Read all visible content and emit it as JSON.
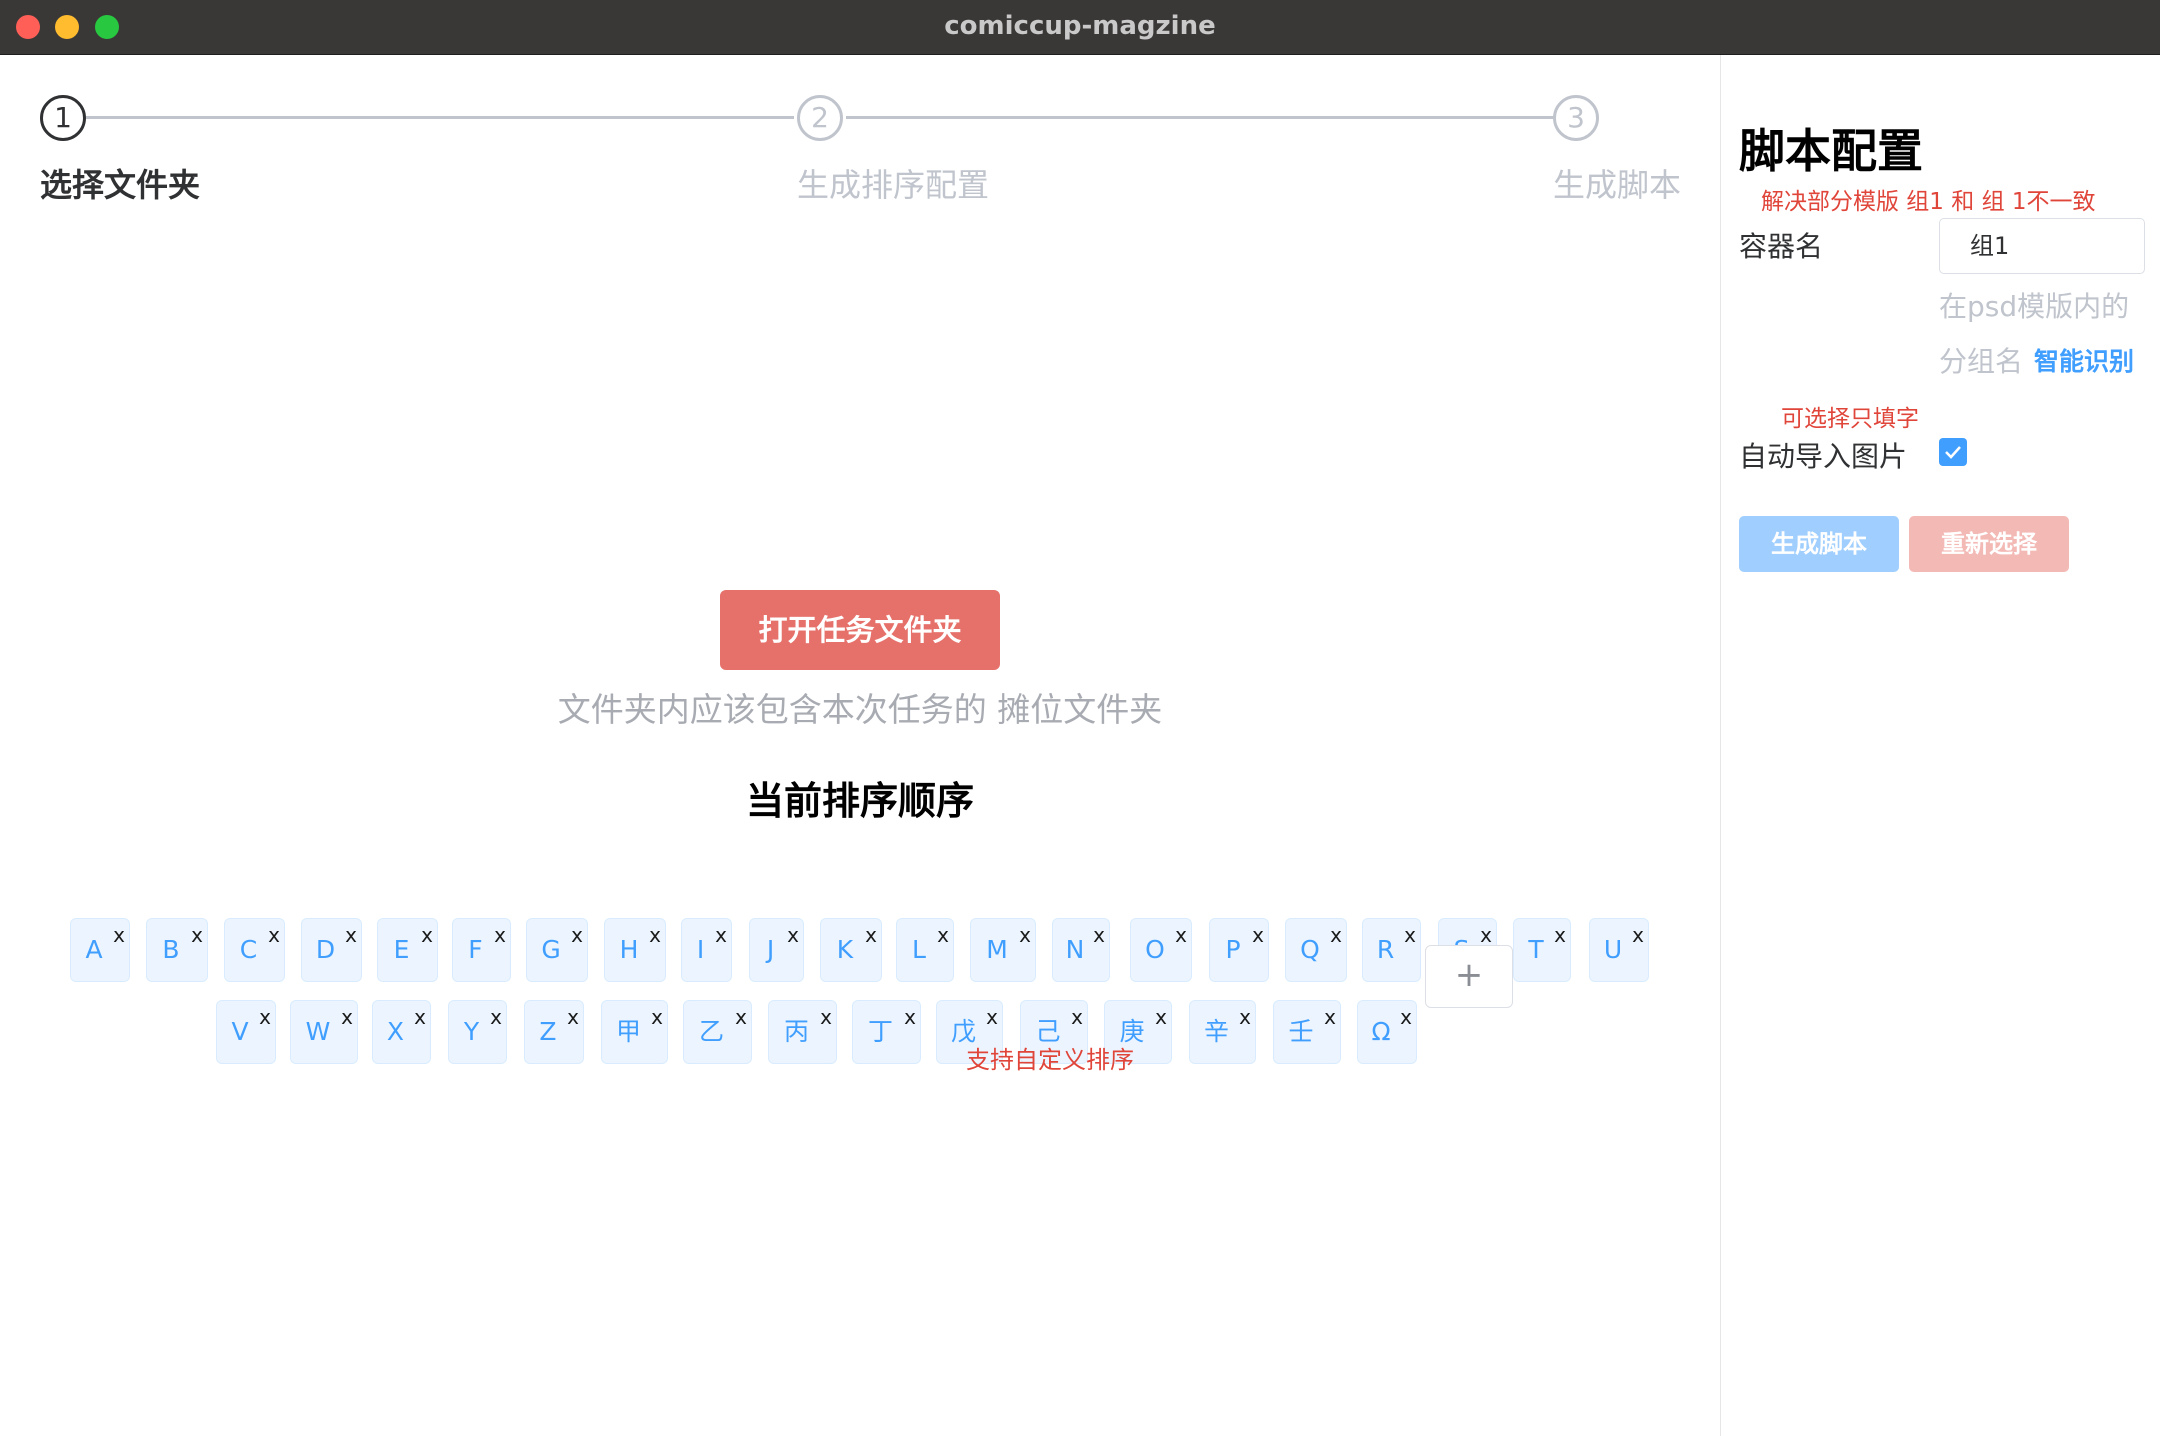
{
  "window": {
    "title": "comiccup-magzine"
  },
  "steps": [
    {
      "number": "1",
      "title": "选择文件夹",
      "state": "active"
    },
    {
      "number": "2",
      "title": "生成排序配置",
      "state": "wait"
    },
    {
      "number": "3",
      "title": "生成脚本",
      "state": "wait"
    }
  ],
  "main": {
    "open_button": "打开任务文件夹",
    "hint": "文件夹内应该包含本次任务的 摊位文件夹",
    "order_title": "当前排序顺序",
    "order_tags": [
      "A",
      "B",
      "C",
      "D",
      "E",
      "F",
      "G",
      "H",
      "I",
      "J",
      "K",
      "L",
      "M",
      "N",
      "O",
      "P",
      "Q",
      "R",
      "S",
      "T",
      "U",
      "V",
      "W",
      "X",
      "Y",
      "Z",
      "甲",
      "乙",
      "丙",
      "丁",
      "戊",
      "己",
      "庚",
      "辛",
      "壬",
      "Ω"
    ],
    "tag_close": "x",
    "add_tag": "+",
    "custom_note": "支持自定义排序"
  },
  "sidebar": {
    "title": "脚本配置",
    "warning": "解决部分模版 组1 和 组 1不一致",
    "container_label": "容器名",
    "container_value": "组1",
    "container_desc_1": "在psd模版内的",
    "container_desc_2": "分组名",
    "smart_detect": "智能识别",
    "optional_note": "可选择只填字",
    "auto_import_label": "自动导入图片",
    "auto_import_checked": true,
    "generate_button": "生成脚本",
    "reset_button": "重新选择"
  },
  "colors": {
    "accent": "#409eff",
    "danger": "#e6716b",
    "warning_text": "#e0453a",
    "tag_bg": "#ecf5ff"
  }
}
